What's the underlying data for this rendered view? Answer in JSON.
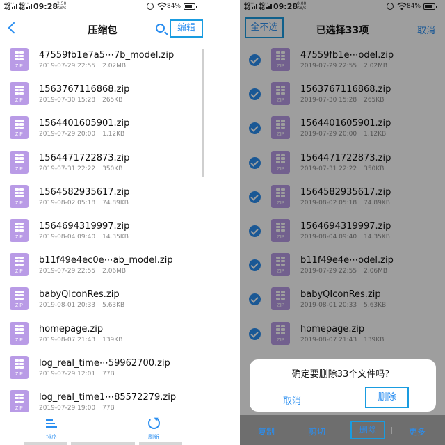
{
  "status_bar": {
    "signal1": "4G⁺⁺\n4G",
    "signal2": "4G⁺⁺\n4G",
    "time": "09:28",
    "speed_left": "2.50\nKB/s",
    "speed_right": "0.00\nKB/s",
    "battery": "84%"
  },
  "left": {
    "title": "压缩包",
    "edit_label": "编辑",
    "icon_label": "ZIP",
    "files": [
      {
        "name": "47559fb1e7a5⋯7b_model.zip",
        "date": "2019-07-29 22:55",
        "size": "2.02MB"
      },
      {
        "name": "1563767116868.zip",
        "date": "2019-07-30 15:28",
        "size": "265KB"
      },
      {
        "name": "1564401605901.zip",
        "date": "2019-07-29 20:00",
        "size": "1.12KB"
      },
      {
        "name": "1564471722873.zip",
        "date": "2019-07-31 22:22",
        "size": "350KB"
      },
      {
        "name": "1564582935617.zip",
        "date": "2019-08-02 05:18",
        "size": "74.89KB"
      },
      {
        "name": "1564694319997.zip",
        "date": "2019-08-04 09:40",
        "size": "14.35KB"
      },
      {
        "name": "b11f49e4ec0e⋯ab_model.zip",
        "date": "2019-07-29 22:55",
        "size": "2.06MB"
      },
      {
        "name": "babyQIconRes.zip",
        "date": "2019-08-01 20:33",
        "size": "5.63KB"
      },
      {
        "name": "homepage.zip",
        "date": "2019-08-07 21:43",
        "size": "139KB"
      },
      {
        "name": "log_real_time⋯59962700.zip",
        "date": "2019-07-29 12:01",
        "size": "77B"
      },
      {
        "name": "log_real_time1⋯85572279.zip",
        "date": "2019-07-29 19:00",
        "size": "77B"
      }
    ],
    "bottom": {
      "sort_label": "排序",
      "refresh_label": "刷新"
    }
  },
  "right": {
    "select_none_label": "全不选",
    "title": "已选择33项",
    "cancel_label": "取消",
    "files": [
      {
        "name": "47559fb1e⋯odel.zip",
        "date": "2019-07-29 22:55",
        "size": "2.02MB"
      },
      {
        "name": "1563767116868.zip",
        "date": "2019-07-30 15:28",
        "size": "265KB"
      },
      {
        "name": "1564401605901.zip",
        "date": "2019-07-29 20:00",
        "size": "1.12KB"
      },
      {
        "name": "1564471722873.zip",
        "date": "2019-07-31 22:22",
        "size": "350KB"
      },
      {
        "name": "1564582935617.zip",
        "date": "2019-08-02 05:18",
        "size": "74.89KB"
      },
      {
        "name": "1564694319997.zip",
        "date": "2019-08-04 09:40",
        "size": "14.35KB"
      },
      {
        "name": "b11f49e4e⋯odel.zip",
        "date": "2019-07-29 22:55",
        "size": "2.06MB"
      },
      {
        "name": "babyQIconRes.zip",
        "date": "2019-08-01 20:33",
        "size": "5.63KB"
      },
      {
        "name": "homepage.zip",
        "date": "2019-08-07 21:43",
        "size": "139KB"
      }
    ],
    "dialog": {
      "message": "确定要删除33个文件吗？",
      "cancel_label": "取消",
      "delete_label": "删除"
    },
    "actions": {
      "copy": "复制",
      "cut": "剪切",
      "delete": "删除",
      "more": "更多"
    }
  },
  "colors": {
    "accent": "#2a8ef0",
    "highlight_box": "#1a9ce0",
    "zip_icon": "#b99be6"
  }
}
